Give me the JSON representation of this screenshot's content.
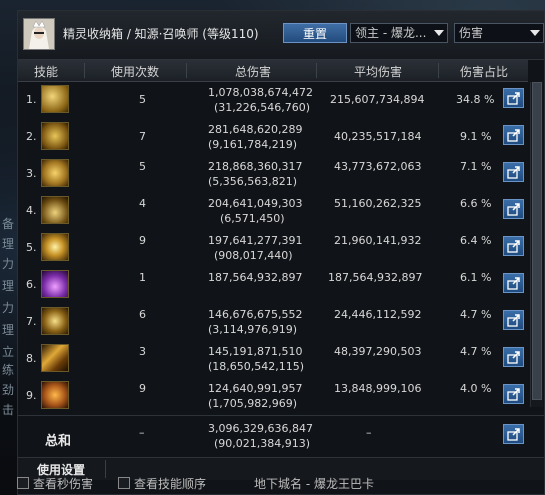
{
  "header": {
    "title": "精灵收纳箱 / 知源·召唤师 (等级110)",
    "reset_label": "重置",
    "target_select": "领主 - 爆龙...",
    "metric_select": "伤害"
  },
  "columns": {
    "skill": "技能",
    "uses": "使用次数",
    "total": "总伤害",
    "avg": "平均伤害",
    "share": "伤害占比"
  },
  "rows": [
    {
      "rank": "1.",
      "uses": "5",
      "total": "1,078,038,674,472",
      "total_sub": "(31,226,546,760)",
      "avg": "215,607,734,894",
      "share": "34.8 %",
      "icon_color": "#c9a33a"
    },
    {
      "rank": "2.",
      "uses": "7",
      "total": "281,648,620,289",
      "total_sub": "(9,161,784,219)",
      "avg": "40,235,517,184",
      "share": "9.1 %",
      "icon_color": "#b8902e"
    },
    {
      "rank": "3.",
      "uses": "5",
      "total": "218,868,360,317",
      "total_sub": "(5,356,563,821)",
      "avg": "43,773,672,063",
      "share": "7.1 %",
      "icon_color": "#d2a63c"
    },
    {
      "rank": "4.",
      "uses": "4",
      "total": "204,641,049,303",
      "total_sub": "(6,571,450)",
      "avg": "51,160,262,325",
      "share": "6.6 %",
      "icon_color": "#a8842a"
    },
    {
      "rank": "5.",
      "uses": "9",
      "total": "197,641,277,391",
      "total_sub": "(908,017,440)",
      "avg": "21,960,141,932",
      "share": "6.4 %",
      "icon_color": "#e0b850"
    },
    {
      "rank": "6.",
      "uses": "1",
      "total": "187,564,932,897",
      "total_sub": "",
      "avg": "187,564,932,897",
      "share": "6.1 %",
      "icon_color": "#9b4fc2"
    },
    {
      "rank": "7.",
      "uses": "6",
      "total": "146,676,675,552",
      "total_sub": "(3,114,976,919)",
      "avg": "24,446,112,592",
      "share": "4.7 %",
      "icon_color": "#c49a36"
    },
    {
      "rank": "8.",
      "uses": "3",
      "total": "145,191,871,510",
      "total_sub": "(18,650,542,115)",
      "avg": "48,397,290,503",
      "share": "4.7 %",
      "icon_color": "#d59a2a"
    },
    {
      "rank": "9.",
      "uses": "9",
      "total": "124,640,991,957",
      "total_sub": "(1,705,982,969)",
      "avg": "13,848,999,106",
      "share": "4.0 %",
      "icon_color": "#c07a22"
    }
  ],
  "totals": {
    "label": "总和",
    "uses": "–",
    "total": "3,096,329,636,847",
    "total_sub": "(90,021,384,913)",
    "avg": "–"
  },
  "settings": {
    "label": "使用设置"
  },
  "footer": {
    "opt1": "查看秒伤害",
    "opt2": "查看技能顺序",
    "location": "地下城名 - 爆龙王巴卡"
  },
  "left_strip": [
    "备",
    "理",
    "力",
    "理",
    "力",
    "理",
    "立",
    "练",
    "劲",
    "击",
    "击"
  ],
  "colors": {
    "accent": "#2b5d96",
    "panel_bg": "#101317",
    "header_bg": "#1c2026"
  }
}
